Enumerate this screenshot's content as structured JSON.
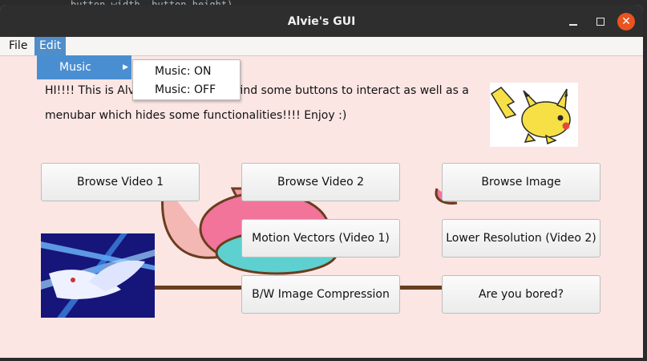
{
  "editor_background_line": "button_width, button_height)",
  "window": {
    "title": "Alvie's GUI",
    "close_glyph": "✕"
  },
  "menubar": {
    "file_label": "File",
    "edit_label": "Edit"
  },
  "edit_menu": {
    "music_label": "Music",
    "submenu_arrow": "▶"
  },
  "music_submenu": {
    "items": [
      "Music: ON",
      "Music: OFF"
    ]
  },
  "intro_text": {
    "line1_start": "HI!!!! This is Alvie",
    "line1_end": "find some buttons to interact as well as a",
    "line2": "menubar which hides some functionalities!!!! Enjoy :)"
  },
  "buttons": [
    "Browse Video 1",
    "Browse Video 2",
    "Browse Image",
    "Motion Vectors (Video 1)",
    "Lower Resolution (Video 2)",
    "B/W Image Compression",
    "Are you bored?"
  ],
  "icons": {
    "window_min": "minimize-icon",
    "window_max": "maximize-icon",
    "window_close": "close-icon",
    "submenu": "chevron-right-icon"
  },
  "colors": {
    "menu_highlight": "#4f8ec9",
    "content_bg": "#fbe6e4",
    "close_button": "#e95420",
    "titlebar": "#2e2e2e"
  }
}
